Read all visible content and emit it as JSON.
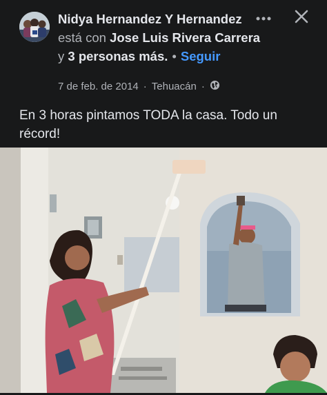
{
  "post": {
    "author": "Nidya Hernandez Y Hernandez",
    "connector": "está con",
    "tagged_person": "Jose Luis Rivera Carrera",
    "and_word": "y",
    "others": "3 personas más",
    "period": ".",
    "bullet": "•",
    "follow_label": "Seguir",
    "date": "7 de feb. de 2014",
    "meta_dot": "·",
    "location": "Tehuacán",
    "text": "En 3 horas pintamos TODA la casa. Todo un récord!"
  },
  "icons": {
    "more": "more-horizontal-icon",
    "close": "close-icon",
    "privacy": "globe-icon"
  },
  "colors": {
    "background": "#18191a",
    "text": "#e4e6eb",
    "secondary_text": "#b0b3b8",
    "link": "#4599ff"
  }
}
